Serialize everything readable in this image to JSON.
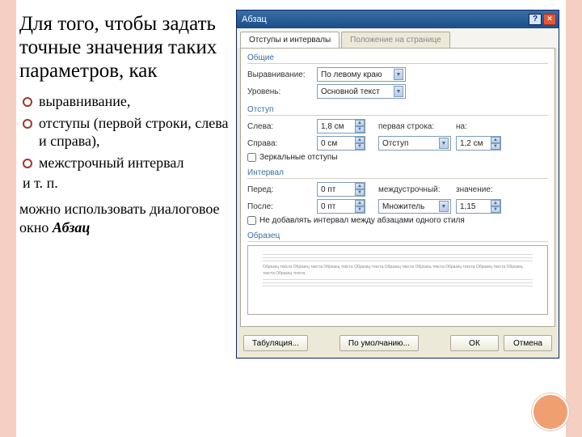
{
  "left": {
    "heading": "Для того, чтобы задать точные значения таких параметров, как",
    "bullets": [
      "выравнивание,",
      "отступы (первой строки, слева и справа),",
      "межстрочный интервал"
    ],
    "tail": "и т. п.",
    "footer_text": "можно использовать диалоговое окно ",
    "footer_em": "Абзац"
  },
  "dialog": {
    "title": "Абзац",
    "help_btn": "?",
    "close_btn": "×",
    "tabs": {
      "active": "Отступы и интервалы",
      "inactive": "Положение на странице"
    },
    "groups": {
      "general": {
        "title": "Общие",
        "alignment_label": "Выравнивание:",
        "alignment_value": "По левому краю",
        "level_label": "Уровень:",
        "level_value": "Основной текст"
      },
      "indent": {
        "title": "Отступ",
        "left_label": "Слева:",
        "left_value": "1,8 см",
        "right_label": "Справа:",
        "right_value": "0 см",
        "first_label": "первая строка:",
        "first_value": "на:",
        "type_label": "Отступ",
        "type_value": "1,2 см",
        "mirror": "Зеркальные отступы"
      },
      "spacing": {
        "title": "Интервал",
        "before_label": "Перед:",
        "before_value": "0 пт",
        "after_label": "После:",
        "after_value": "0 пт",
        "line_label": "междустрочный:",
        "line_value": "значение:",
        "mult_label": "Множитель",
        "mult_value": "1,15",
        "noadd": "Не добавлять интервал между абзацами одного стиля"
      },
      "preview": {
        "title": "Образец",
        "sample": "Образец текста Образец текста Образец текста Образец текста Образец текста Образец текста Образец текста Образец текста Образец текста Образец текста"
      }
    },
    "buttons": {
      "tabs_btn": "Табуляция...",
      "default_btn": "По умолчанию...",
      "ok": "ОК",
      "cancel": "Отмена"
    }
  }
}
